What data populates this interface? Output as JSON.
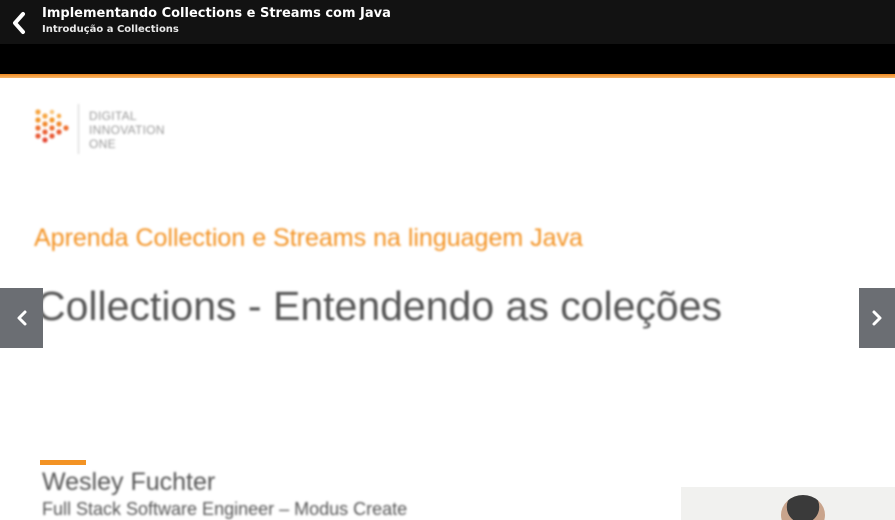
{
  "header": {
    "title": "Implementando Collections e Streams com Java",
    "subtitle": "Introdução a Collections",
    "back_icon": "chevron-left-icon"
  },
  "slide": {
    "logo": {
      "line1": "DIGITAL",
      "line2": "INNOVATION",
      "line3": "ONE"
    },
    "subheading": "Aprenda Collection e Streams na linguagem Java",
    "heading": "Collections - Entendendo as coleções",
    "speaker": {
      "name": "Wesley Fuchter",
      "role": "Full Stack Software Engineer – Modus Create"
    }
  },
  "navigation": {
    "prev_icon": "chevron-left-icon",
    "next_icon": "chevron-right-icon"
  },
  "colors": {
    "topbar": "#121212",
    "accent_orange": "#f39324",
    "heading_gray": "#555555",
    "nav_button": "#6b6e73"
  }
}
